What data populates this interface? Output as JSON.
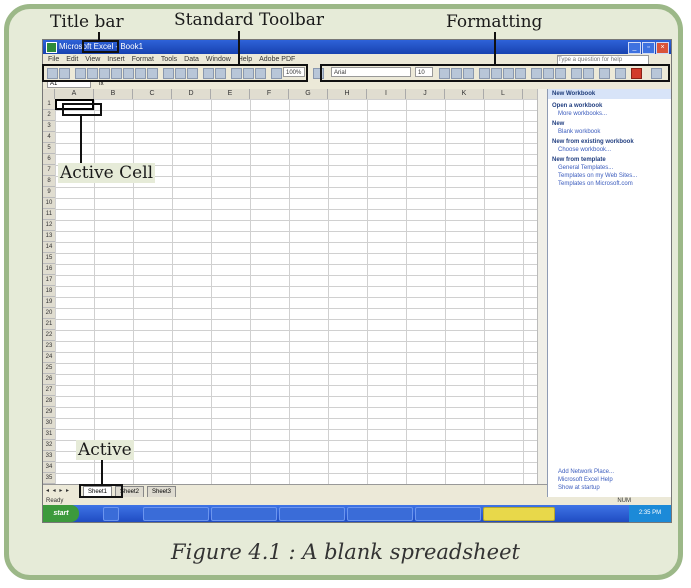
{
  "annotations": {
    "title_bar": "Title bar",
    "standard_toolbar": "Standard Toolbar",
    "formatting": "Formatting",
    "active_cell": "Active Cell",
    "active": "Active"
  },
  "caption": "Figure 4.1 : A blank spreadsheet",
  "window": {
    "title": "Microsoft Excel - Book1"
  },
  "menubar": {
    "items": [
      "File",
      "Edit",
      "View",
      "Insert",
      "Format",
      "Tools",
      "Data",
      "Window",
      "Help",
      "Adobe PDF"
    ],
    "help_placeholder": "Type a question for help"
  },
  "toolbar": {
    "font_name": "Arial",
    "font_size": "10",
    "zoom": "100%"
  },
  "formula_bar": {
    "name_box": "A1",
    "fx": "fx"
  },
  "grid": {
    "columns": [
      "A",
      "B",
      "C",
      "D",
      "E",
      "F",
      "G",
      "H",
      "I",
      "J",
      "K",
      "L"
    ],
    "rows": [
      "1",
      "2",
      "3",
      "4",
      "5",
      "6",
      "7",
      "8",
      "9",
      "10",
      "11",
      "12",
      "13",
      "14",
      "15",
      "16",
      "17",
      "18",
      "19",
      "20",
      "21",
      "22",
      "23",
      "24",
      "25",
      "26",
      "27",
      "28",
      "29",
      "30",
      "31",
      "32",
      "33",
      "34",
      "35"
    ]
  },
  "task_pane": {
    "title": "New Workbook",
    "sections": [
      {
        "heading": "Open a workbook",
        "links": [
          "More workbooks..."
        ]
      },
      {
        "heading": "New",
        "links": [
          "Blank workbook"
        ]
      },
      {
        "heading": "New from existing workbook",
        "links": [
          "Choose workbook..."
        ]
      },
      {
        "heading": "New from template",
        "links": [
          "General Templates...",
          "Templates on my Web Sites...",
          "Templates on Microsoft.com"
        ]
      }
    ],
    "footer_links": [
      "Add Network Place...",
      "Microsoft Excel Help",
      "Show at startup"
    ]
  },
  "sheet_tabs": [
    "Sheet1",
    "Sheet2",
    "Sheet3"
  ],
  "status": {
    "left": "Ready",
    "right": "NUM"
  },
  "taskbar": {
    "start": "start",
    "clock": "2:35 PM"
  }
}
